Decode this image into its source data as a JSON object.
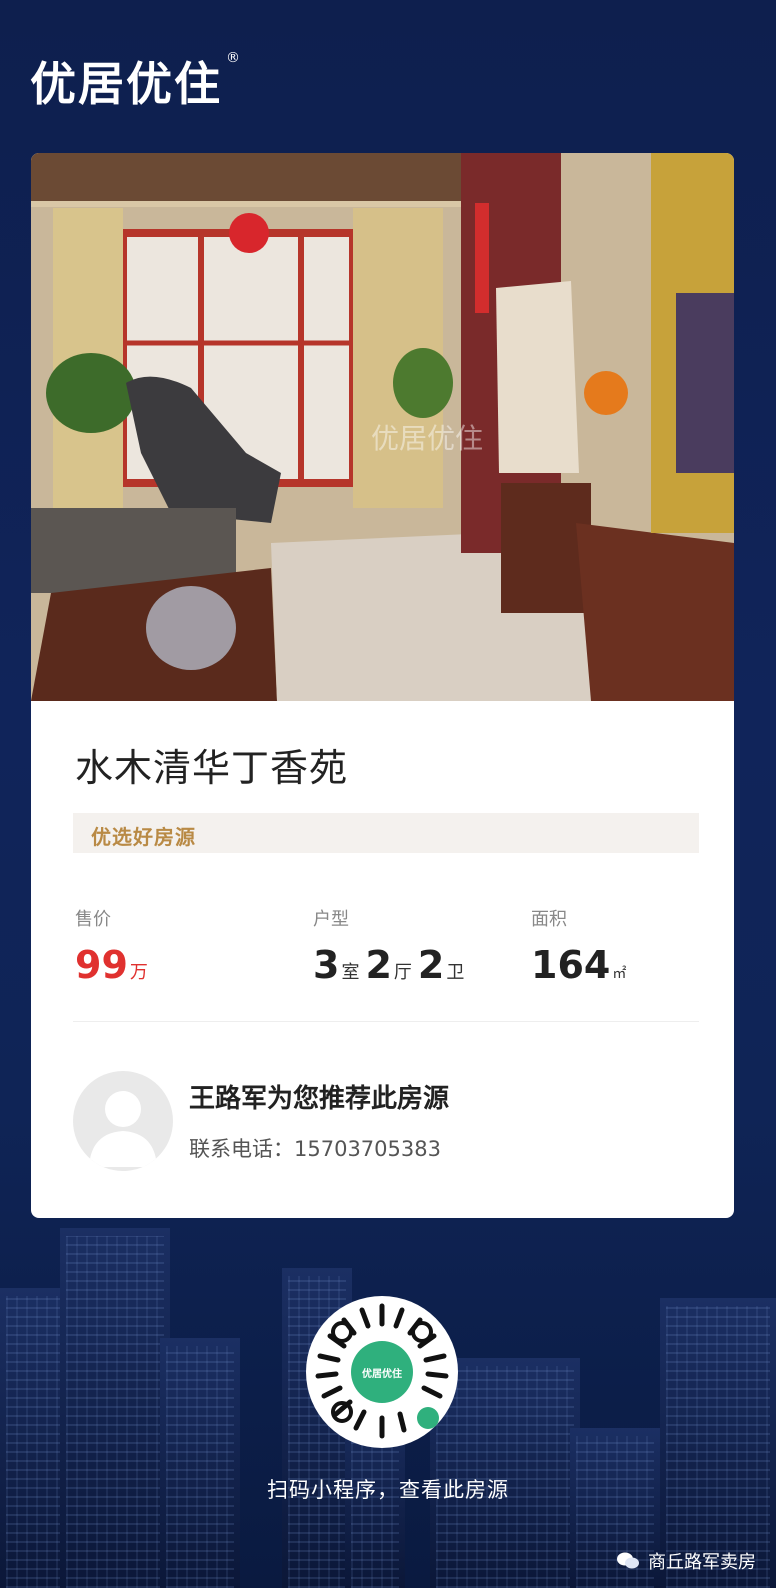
{
  "brand": {
    "logo_text": "优居优住",
    "registered_mark": "®"
  },
  "listing": {
    "name": "水木清华丁香苑",
    "tag": "优选好房源",
    "price": {
      "label": "售价",
      "value": "99",
      "unit": "万"
    },
    "layout": {
      "label": "户型",
      "rooms": "3",
      "rooms_unit": "室",
      "halls": "2",
      "halls_unit": "厅",
      "baths": "2",
      "baths_unit": "卫"
    },
    "area": {
      "label": "面积",
      "value": "164",
      "unit": "㎡"
    }
  },
  "agent": {
    "recommend_text": "王路军为您推荐此房源",
    "phone_label": "联系电话：",
    "phone": "15703705383"
  },
  "qr": {
    "center_label": "优居优住",
    "caption": "扫码小程序，查看此房源"
  },
  "source": {
    "account": "商丘路军卖房",
    "icon": "wechat-icon"
  },
  "colors": {
    "accent_red": "#e0312f",
    "tag_gold": "#b98a45",
    "bg_navy": "#10245a",
    "qr_green": "#2fb07d"
  }
}
